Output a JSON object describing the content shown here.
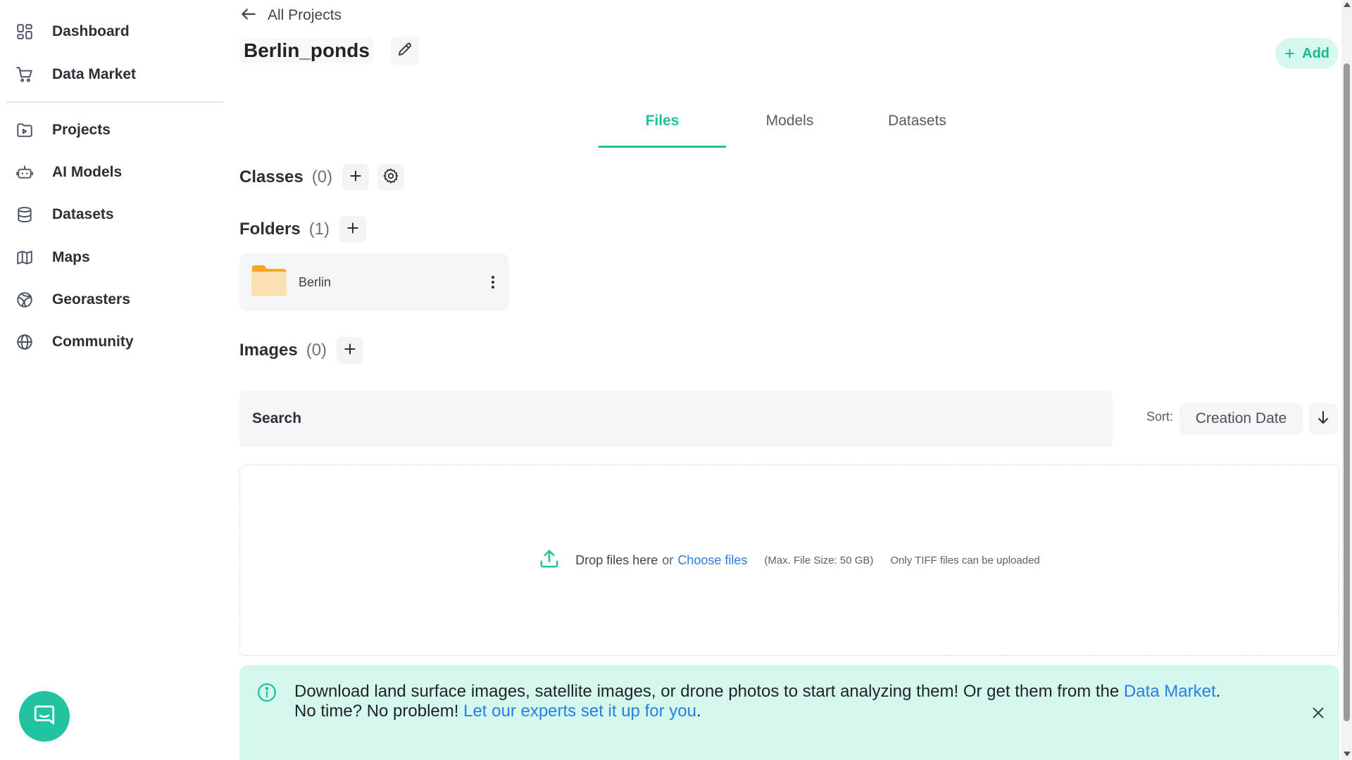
{
  "sidebar": {
    "items": [
      {
        "label": "Dashboard",
        "icon": "dashboard-icon"
      },
      {
        "label": "Data Market",
        "icon": "cart-icon"
      },
      {
        "label": "Projects",
        "icon": "project-folder-icon"
      },
      {
        "label": "AI Models",
        "icon": "robot-icon"
      },
      {
        "label": "Datasets",
        "icon": "database-icon"
      },
      {
        "label": "Maps",
        "icon": "map-icon"
      },
      {
        "label": "Georasters",
        "icon": "globe-grid-icon"
      },
      {
        "label": "Community",
        "icon": "globe-icon"
      }
    ]
  },
  "header": {
    "back_label": "All Projects",
    "project_title": "Berlin_ponds",
    "add_label": "Add"
  },
  "tabs": [
    {
      "label": "Files",
      "active": true
    },
    {
      "label": "Models",
      "active": false
    },
    {
      "label": "Datasets",
      "active": false
    }
  ],
  "classes": {
    "title": "Classes",
    "count": "(0)"
  },
  "folders": {
    "title": "Folders",
    "count": "(1)",
    "items": [
      {
        "name": "Berlin"
      }
    ]
  },
  "images": {
    "title": "Images",
    "count": "(0)"
  },
  "search": {
    "placeholder": "Search"
  },
  "sort": {
    "label": "Sort:",
    "value": "Creation Date"
  },
  "dropzone": {
    "drop_text": "Drop files here",
    "or_text": "or",
    "choose_text": "Choose files",
    "max_size": "(Max. File Size: 50 GB)",
    "only_tiff": "Only TIFF files can be uploaded"
  },
  "banner": {
    "text1": "Download land surface images, satellite images, or drone photos to start analyzing them! Or get them from the ",
    "link1": "Data Market",
    "text2": ".",
    "text3": "No time? No problem! ",
    "link2": "Let our experts set it up for you",
    "text4": "."
  },
  "colors": {
    "accent": "#1cc49b",
    "link": "#2a7de1",
    "banner_bg": "#d5f8ee",
    "chat": "#21c4a0",
    "folder": "#f5a623"
  }
}
